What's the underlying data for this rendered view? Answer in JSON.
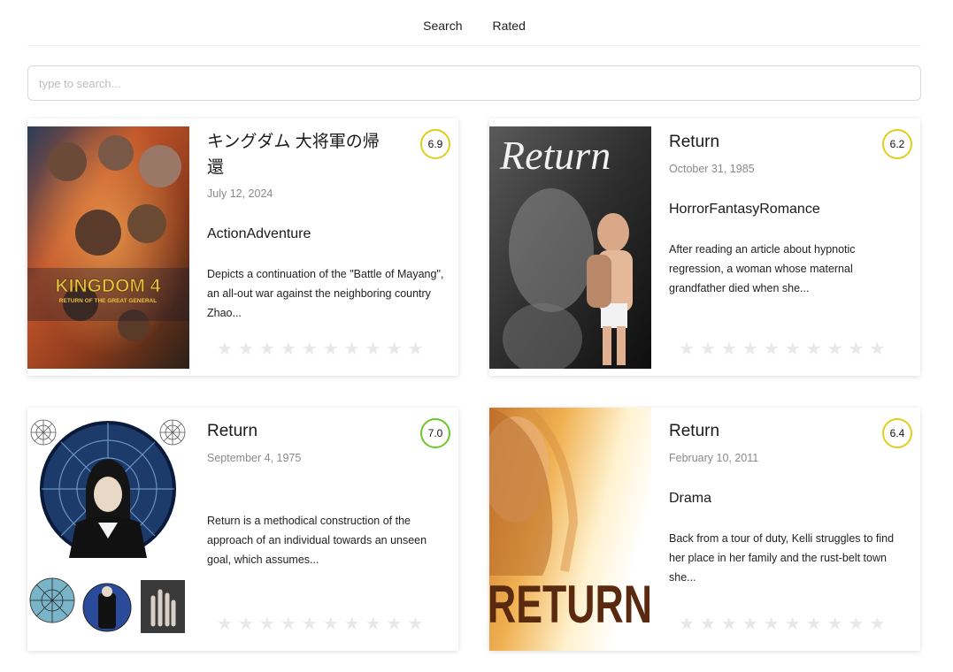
{
  "nav": {
    "items": [
      "Search",
      "Rated"
    ]
  },
  "search": {
    "placeholder": "type to search..."
  },
  "movies": [
    {
      "title": "キングダム 大将軍の帰還",
      "date": "July 12, 2024",
      "genres": "ActionAdventure",
      "overview": "Depicts a continuation of the \"Battle of Mayang\", an all-out war against the neighboring country Zhao...",
      "rating": "6.9",
      "poster_text": "KINGDOM 4",
      "poster_subtext": "RETURN OF THE GREAT GENERAL"
    },
    {
      "title": "Return",
      "date": "October 31, 1985",
      "genres": "HorrorFantasyRomance",
      "overview": "After reading an article about hypnotic regression, a woman whose maternal grandfather died when she...",
      "rating": "6.2",
      "poster_text": "Return"
    },
    {
      "title": "Return",
      "date": "September 4, 1975",
      "genres": "",
      "overview": "Return is a methodical construction of the approach of an individual towards an unseen goal, which assumes...",
      "rating": "7.0"
    },
    {
      "title": "Return",
      "date": "February 10, 2011",
      "genres": "Drama",
      "overview": "Back from a tour of duty, Kelli struggles to find her place in her family and the rust-belt town she...",
      "rating": "6.4",
      "poster_text": "RETURN"
    }
  ],
  "stars": {
    "count": 10,
    "filled": 0,
    "glyph": "★"
  },
  "colors": {
    "rating_yellow": "#e0cd1c",
    "rating_green": "#6ac72c",
    "star_empty": "#e8e8e8"
  }
}
